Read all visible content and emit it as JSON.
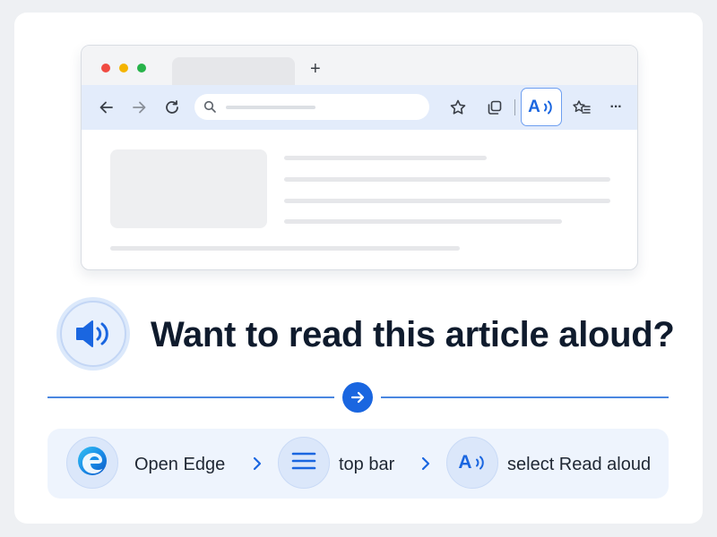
{
  "browser": {
    "new_tab_glyph": "+",
    "read_aloud_icon_label": "A",
    "icons": [
      "back-arrow-icon",
      "forward-arrow-icon",
      "refresh-icon",
      "search-icon",
      "star-icon",
      "collections-icon",
      "read-aloud-icon",
      "favorites-icon",
      "more-icon"
    ],
    "more_glyph": "···"
  },
  "headline": {
    "text": "Want to read this article aloud?"
  },
  "steps": {
    "items": [
      {
        "icon": "edge-logo-icon",
        "label": "Open Edge"
      },
      {
        "icon": "menu-lines-icon",
        "label": "top bar"
      },
      {
        "icon": "read-aloud-icon",
        "icon_label": "A",
        "label": "select Read aloud"
      }
    ]
  },
  "colors": {
    "accent": "#1a66e0",
    "toolbar_bg": "#e3ecfb",
    "steps_bg": "#eef4fd",
    "headline": "#0f1b2d"
  }
}
